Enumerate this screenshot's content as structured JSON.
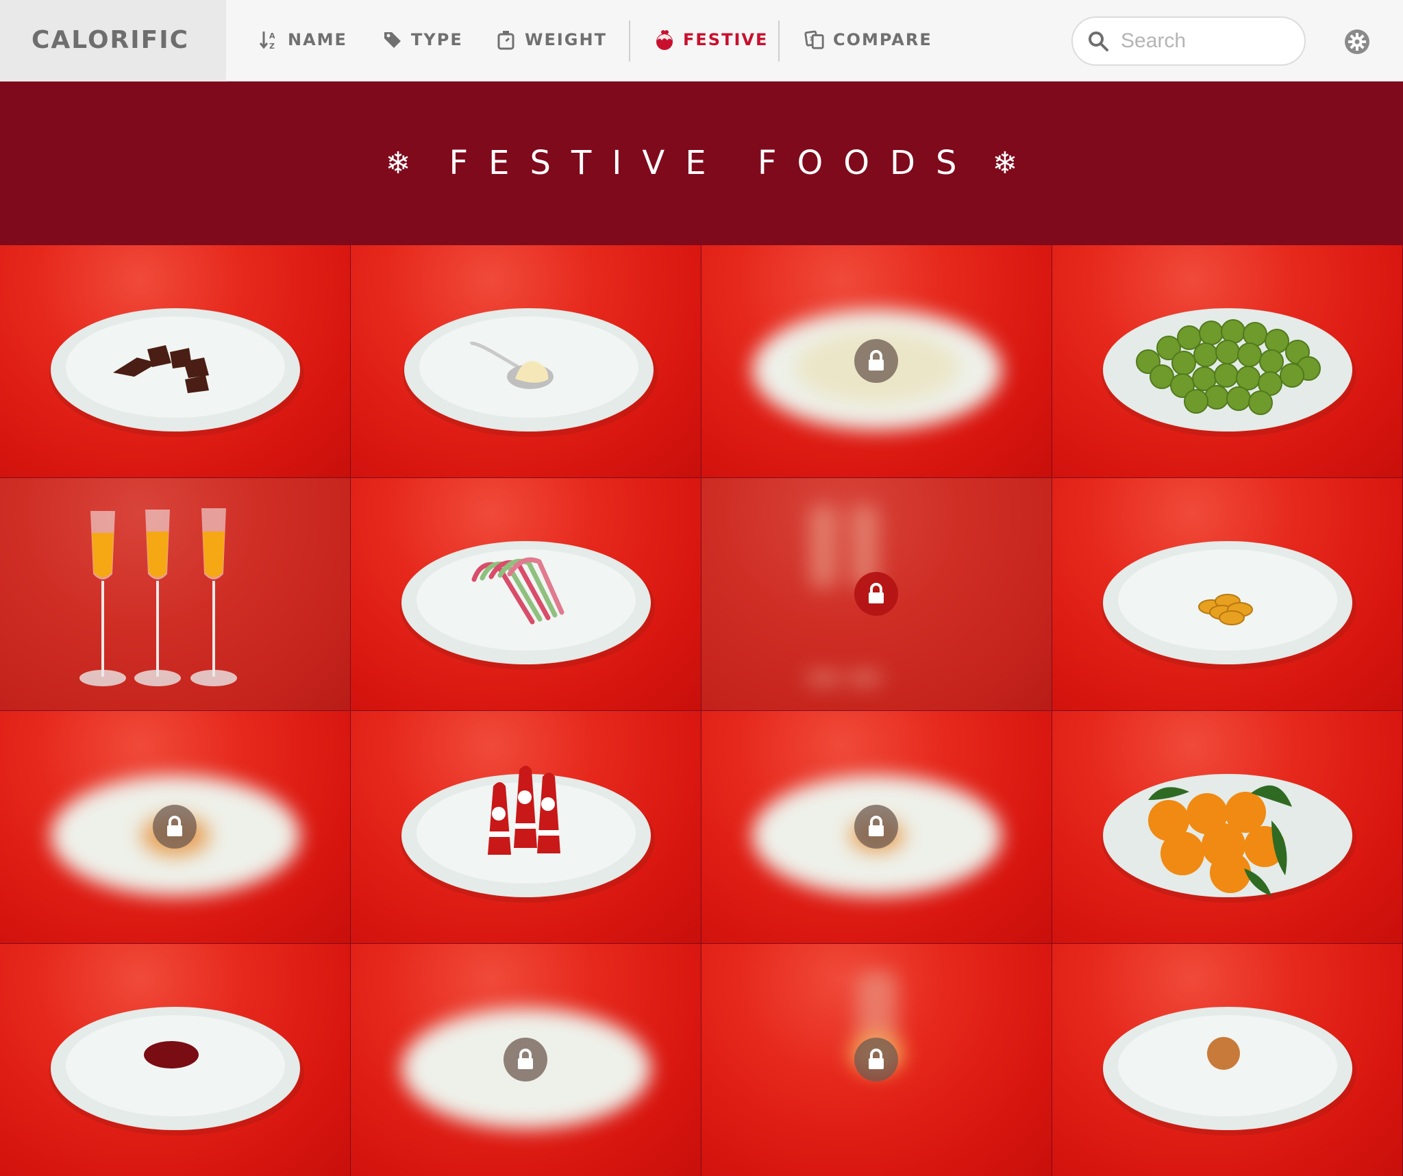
{
  "app": {
    "name": "CALORIFIC"
  },
  "nav": [
    {
      "label": "NAME",
      "icon": "sort-az-icon",
      "active": false
    },
    {
      "label": "TYPE",
      "icon": "tag-icon",
      "active": false
    },
    {
      "label": "WEIGHT",
      "icon": "weight-icon",
      "active": false
    },
    {
      "label": "FESTIVE",
      "icon": "pudding-icon",
      "active": true
    },
    {
      "label": "COMPARE",
      "icon": "compare-cards-icon",
      "active": false
    }
  ],
  "search": {
    "placeholder": "Search",
    "value": ""
  },
  "settings": {
    "icon": "gear-icon"
  },
  "banner": {
    "title": "FESTIVE FOODS",
    "decoration": "❄"
  },
  "colors": {
    "accent": "#c8102e",
    "banner": "#7f0a1c",
    "tile_red": "#d7150f",
    "nav_text": "#707070"
  },
  "tiles": [
    {
      "food": "chocolate-mints",
      "locked": false
    },
    {
      "food": "brandy-butter",
      "locked": false
    },
    {
      "food": "locked-plate",
      "locked": true
    },
    {
      "food": "brussels-sprouts",
      "locked": false
    },
    {
      "food": "bucks-fizz",
      "locked": false
    },
    {
      "food": "candy-canes",
      "locked": false
    },
    {
      "food": "locked-glasses",
      "locked": true
    },
    {
      "food": "chocolate-coins",
      "locked": false
    },
    {
      "food": "locked-plate",
      "locked": true
    },
    {
      "food": "chocolate-santas",
      "locked": false
    },
    {
      "food": "locked-plate",
      "locked": true
    },
    {
      "food": "satsumas",
      "locked": false
    },
    {
      "food": "cranberry-sauce",
      "locked": false
    },
    {
      "food": "locked-plate",
      "locked": true
    },
    {
      "food": "locked-glass",
      "locked": true
    },
    {
      "food": "gingerbread-man",
      "locked": false
    }
  ]
}
